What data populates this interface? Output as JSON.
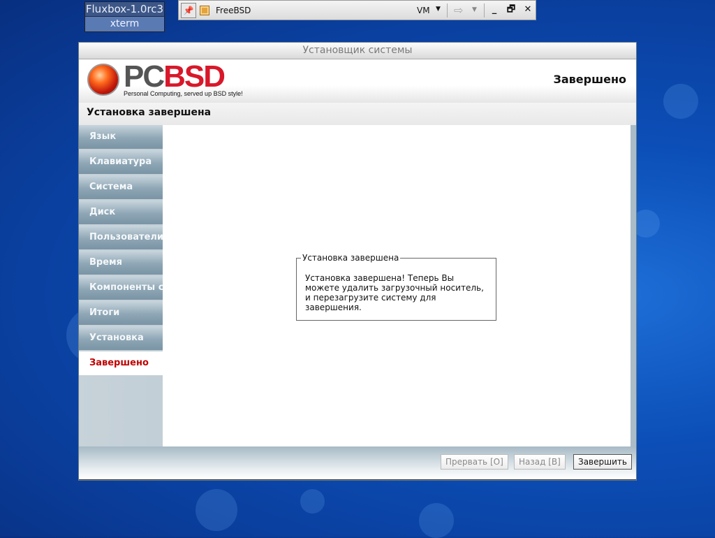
{
  "fluxbox": {
    "workspace_title": "Fluxbox-1.0rc3",
    "workspace_item": "xterm"
  },
  "vm_toolbar": {
    "title": "FreeBSD",
    "vm_label": "VM",
    "pin_glyph": "📌",
    "minimize": "_",
    "restore": "🗗",
    "close": "✕"
  },
  "installer": {
    "window_title": "Установщик системы",
    "logo_part1": "PC",
    "logo_part2": "BSD",
    "logo_tagline": "Personal Computing, served up BSD style!",
    "header_status": "Завершено",
    "section_title": "Установка завершена",
    "sidebar": [
      {
        "label": "Язык"
      },
      {
        "label": "Клавиатура"
      },
      {
        "label": "Система"
      },
      {
        "label": "Диск"
      },
      {
        "label": "Пользователи"
      },
      {
        "label": "Время"
      },
      {
        "label": "Компоненты системы"
      },
      {
        "label": "Итоги"
      },
      {
        "label": "Установка"
      },
      {
        "label": "Завершено"
      }
    ],
    "active_step": "Завершено",
    "groupbox": {
      "legend": "Установка завершена",
      "message": "Установка завершена! Теперь Вы можете удалить загрузочный носитель, и перезагрузите систему для завершения."
    },
    "buttons": {
      "abort": "Прервать [О]",
      "back": "Назад [В]",
      "finish": "Завершить"
    }
  },
  "colors": {
    "accent_active": "#c00000",
    "logo_red": "#d8182a",
    "desktop_blue": "#0c4fb8"
  }
}
